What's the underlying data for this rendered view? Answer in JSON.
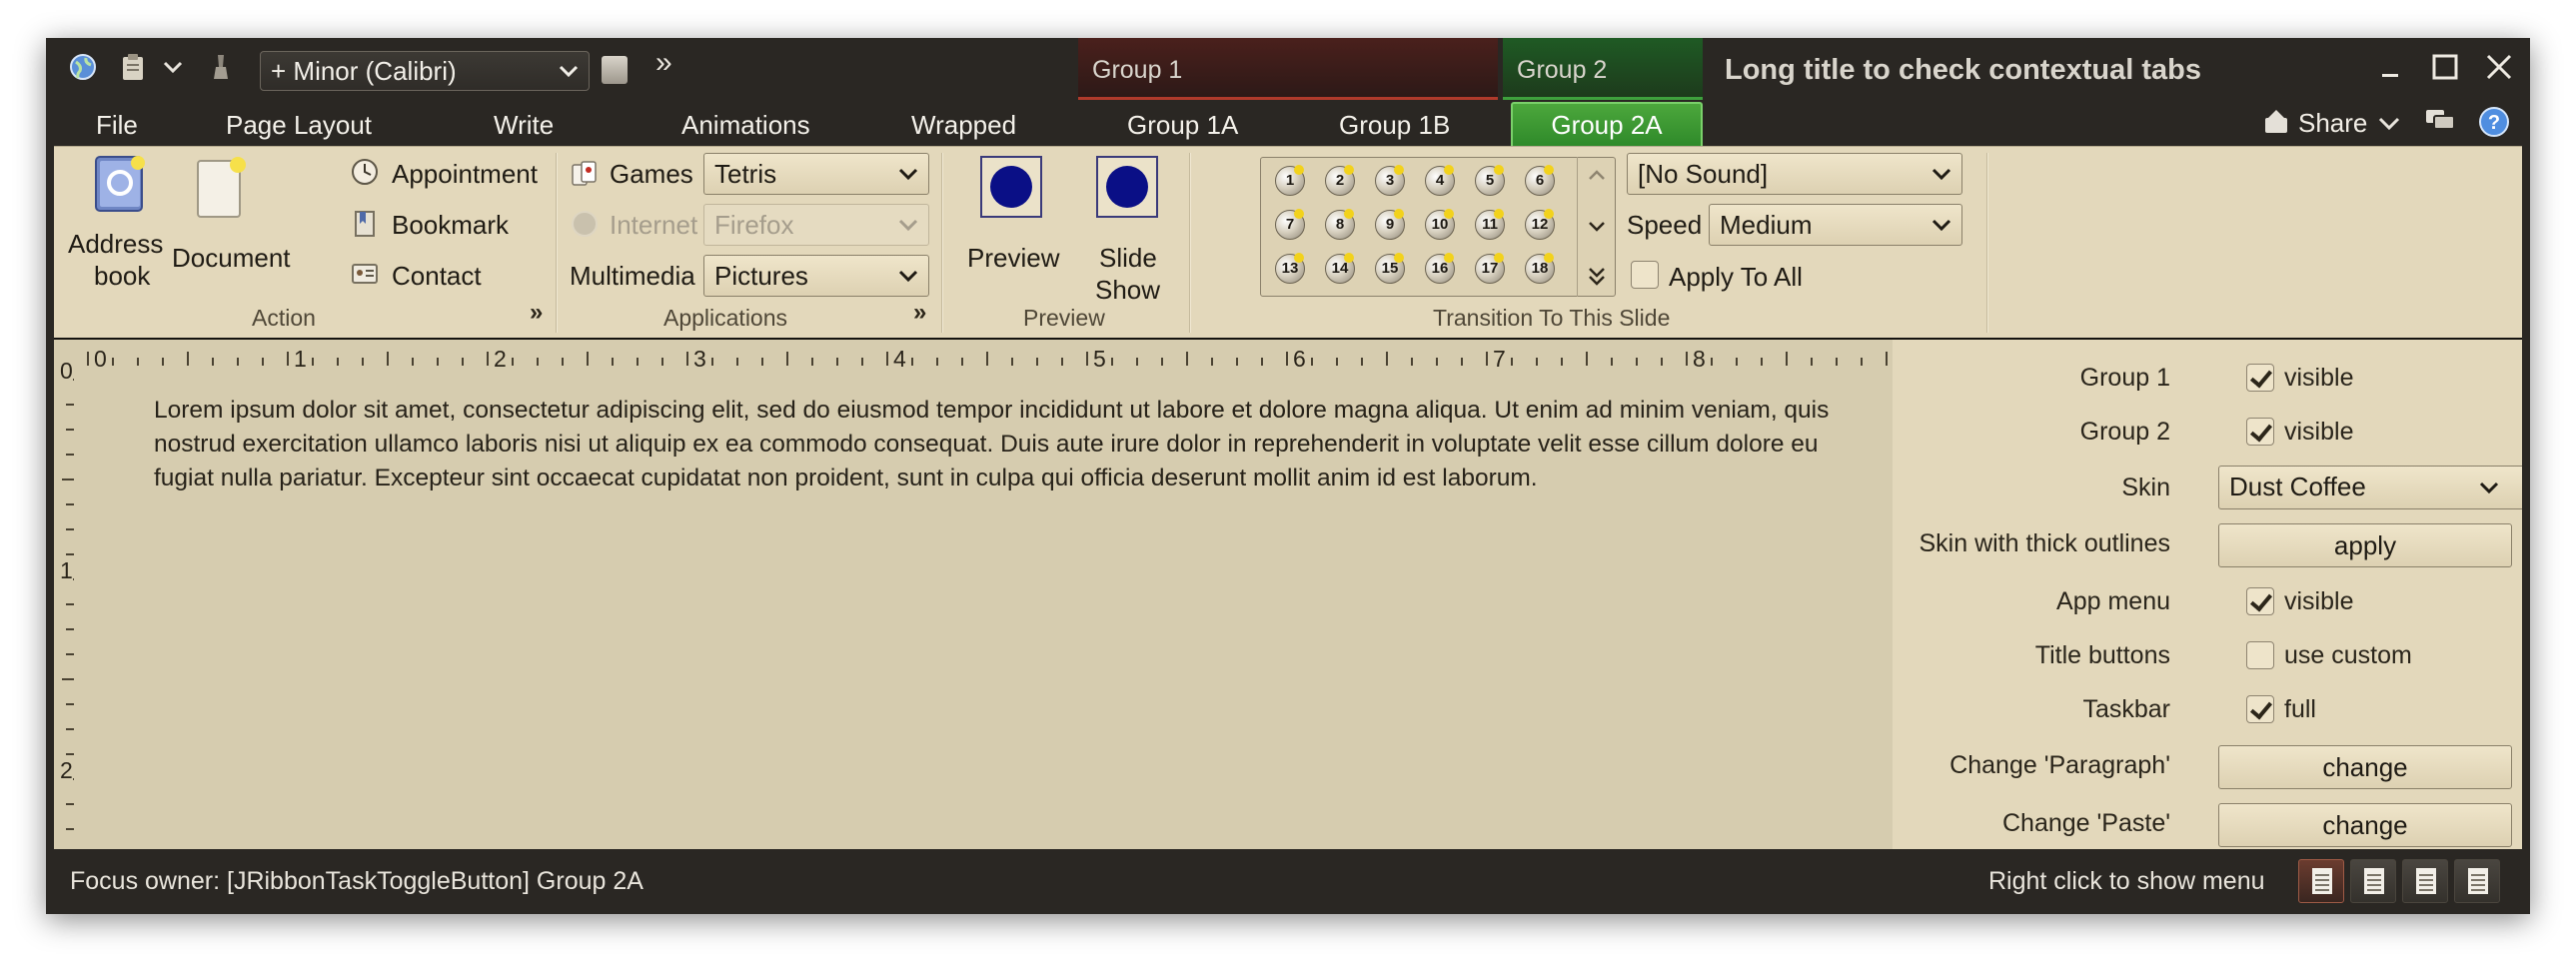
{
  "titlebar": {
    "font_combo": "+ Minor (Calibri)",
    "overflow": "»",
    "group1": "Group 1",
    "group2": "Group 2",
    "window_title": "Long title to check contextual tabs",
    "share": "Share"
  },
  "tabs": [
    "File",
    "Page Layout",
    "Write",
    "Animations",
    "Wrapped",
    "Group 1A",
    "Group 1B",
    "Group 2A"
  ],
  "ribbon": {
    "action": {
      "title": "Action",
      "address_book_line1": "Address",
      "address_book_line2": "book",
      "document": "Document",
      "appointment": "Appointment",
      "bookmark": "Bookmark",
      "contact": "Contact"
    },
    "applications": {
      "title": "Applications",
      "games_label": "Games",
      "games_value": "Tetris",
      "internet_label": "Internet",
      "internet_value": "Firefox",
      "multimedia_label": "Multimedia",
      "multimedia_value": "Pictures"
    },
    "preview": {
      "title": "Preview",
      "preview_label": "Preview",
      "slideshow_line1": "Slide",
      "slideshow_line2": "Show"
    },
    "transition": {
      "title": "Transition To This Slide",
      "gallery": [
        "1",
        "2",
        "3",
        "4",
        "5",
        "6",
        "7",
        "8",
        "9",
        "10",
        "11",
        "12",
        "13",
        "14",
        "15",
        "16",
        "17",
        "18"
      ],
      "sound_value": "[No Sound]",
      "speed_label": "Speed",
      "speed_value": "Medium",
      "apply_all": "Apply To All"
    }
  },
  "ruler": {
    "h": [
      "0",
      "1",
      "2",
      "3",
      "4",
      "5",
      "6",
      "7",
      "8"
    ],
    "v": [
      "0",
      "1",
      "2"
    ]
  },
  "document": {
    "text": "Lorem ipsum dolor sit amet, consectetur adipiscing elit, sed do eiusmod tempor incididunt ut labore et dolore magna aliqua. Ut enim ad minim veniam, quis nostrud exercitation ullamco laboris nisi ut aliquip ex ea commodo consequat. Duis aute irure dolor in reprehenderit in voluptate velit esse cillum dolore eu fugiat nulla pariatur. Excepteur sint occaecat cupidatat non proident, sunt in culpa qui officia deserunt mollit anim id est laborum."
  },
  "panel": {
    "group1_label": "Group 1",
    "group1_value": "visible",
    "group2_label": "Group 2",
    "group2_value": "visible",
    "skin_label": "Skin",
    "skin_value": "Dust Coffee",
    "thick_label": "Skin with thick outlines",
    "thick_button": "apply",
    "appmenu_label": "App menu",
    "appmenu_value": "visible",
    "titlebtn_label": "Title buttons",
    "titlebtn_value": "use custom",
    "taskbar_label": "Taskbar",
    "taskbar_value": "full",
    "paragraph_label": "Change 'Paragraph'",
    "paragraph_button": "change",
    "paste_label": "Change 'Paste'",
    "paste_button": "change"
  },
  "status": {
    "focus": "Focus owner:  [JRibbonTaskToggleButton] Group 2A",
    "right_click": "Right click to show menu"
  },
  "colors": {
    "window_bg": "#2a2723",
    "ribbon_bg": "#e3d8bb",
    "document_bg": "#d6ccaf",
    "group1_accent": "#b03a2b",
    "group2_accent": "#3ea13d"
  }
}
